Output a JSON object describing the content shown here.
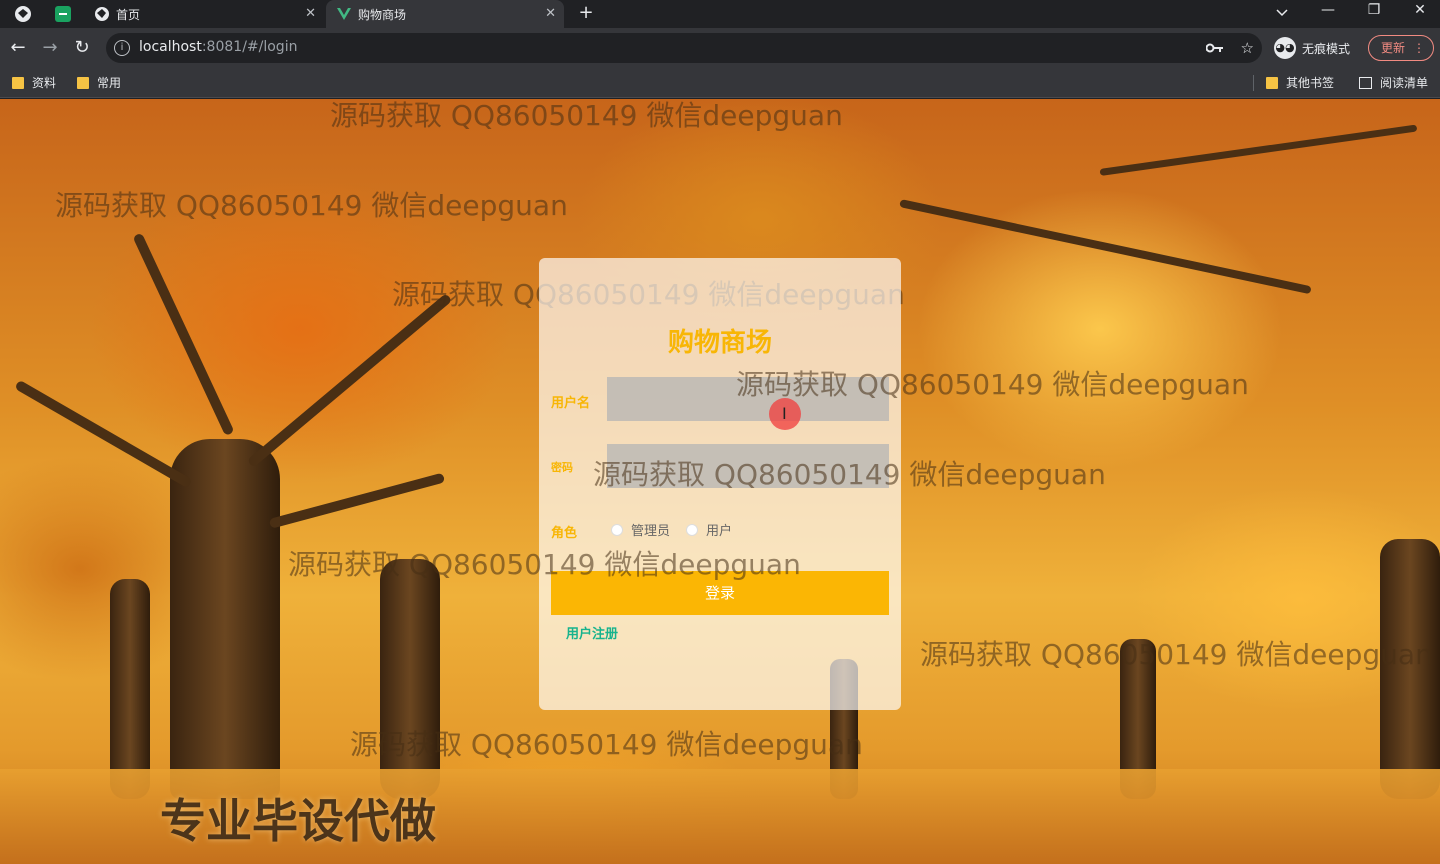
{
  "browser": {
    "tabs": [
      {
        "title": "首页",
        "close": "✕"
      },
      {
        "title": "购物商场",
        "close": "✕"
      }
    ],
    "new_tab": "+",
    "window_controls": {
      "minimize": "—",
      "restore": "❐",
      "close": "✕"
    },
    "url_host": "localhost",
    "url_rest": ":8081/#/login",
    "incognito_label": "无痕模式",
    "update_label": "更新",
    "bookmarks": [
      {
        "label": "资料"
      },
      {
        "label": "常用"
      }
    ],
    "bookmarks_right": [
      {
        "label": "其他书签"
      },
      {
        "label": "阅读清单"
      }
    ]
  },
  "login": {
    "title": "购物商场",
    "username_label": "用户名",
    "password_label": "密码",
    "role_label": "角色",
    "roles": [
      "管理员",
      "用户"
    ],
    "submit_label": "登录",
    "register_link": "用户注册"
  },
  "overlay": {
    "watermark": "源码获取 QQ86050149 微信deepguan",
    "promo": "专业毕设代做"
  }
}
